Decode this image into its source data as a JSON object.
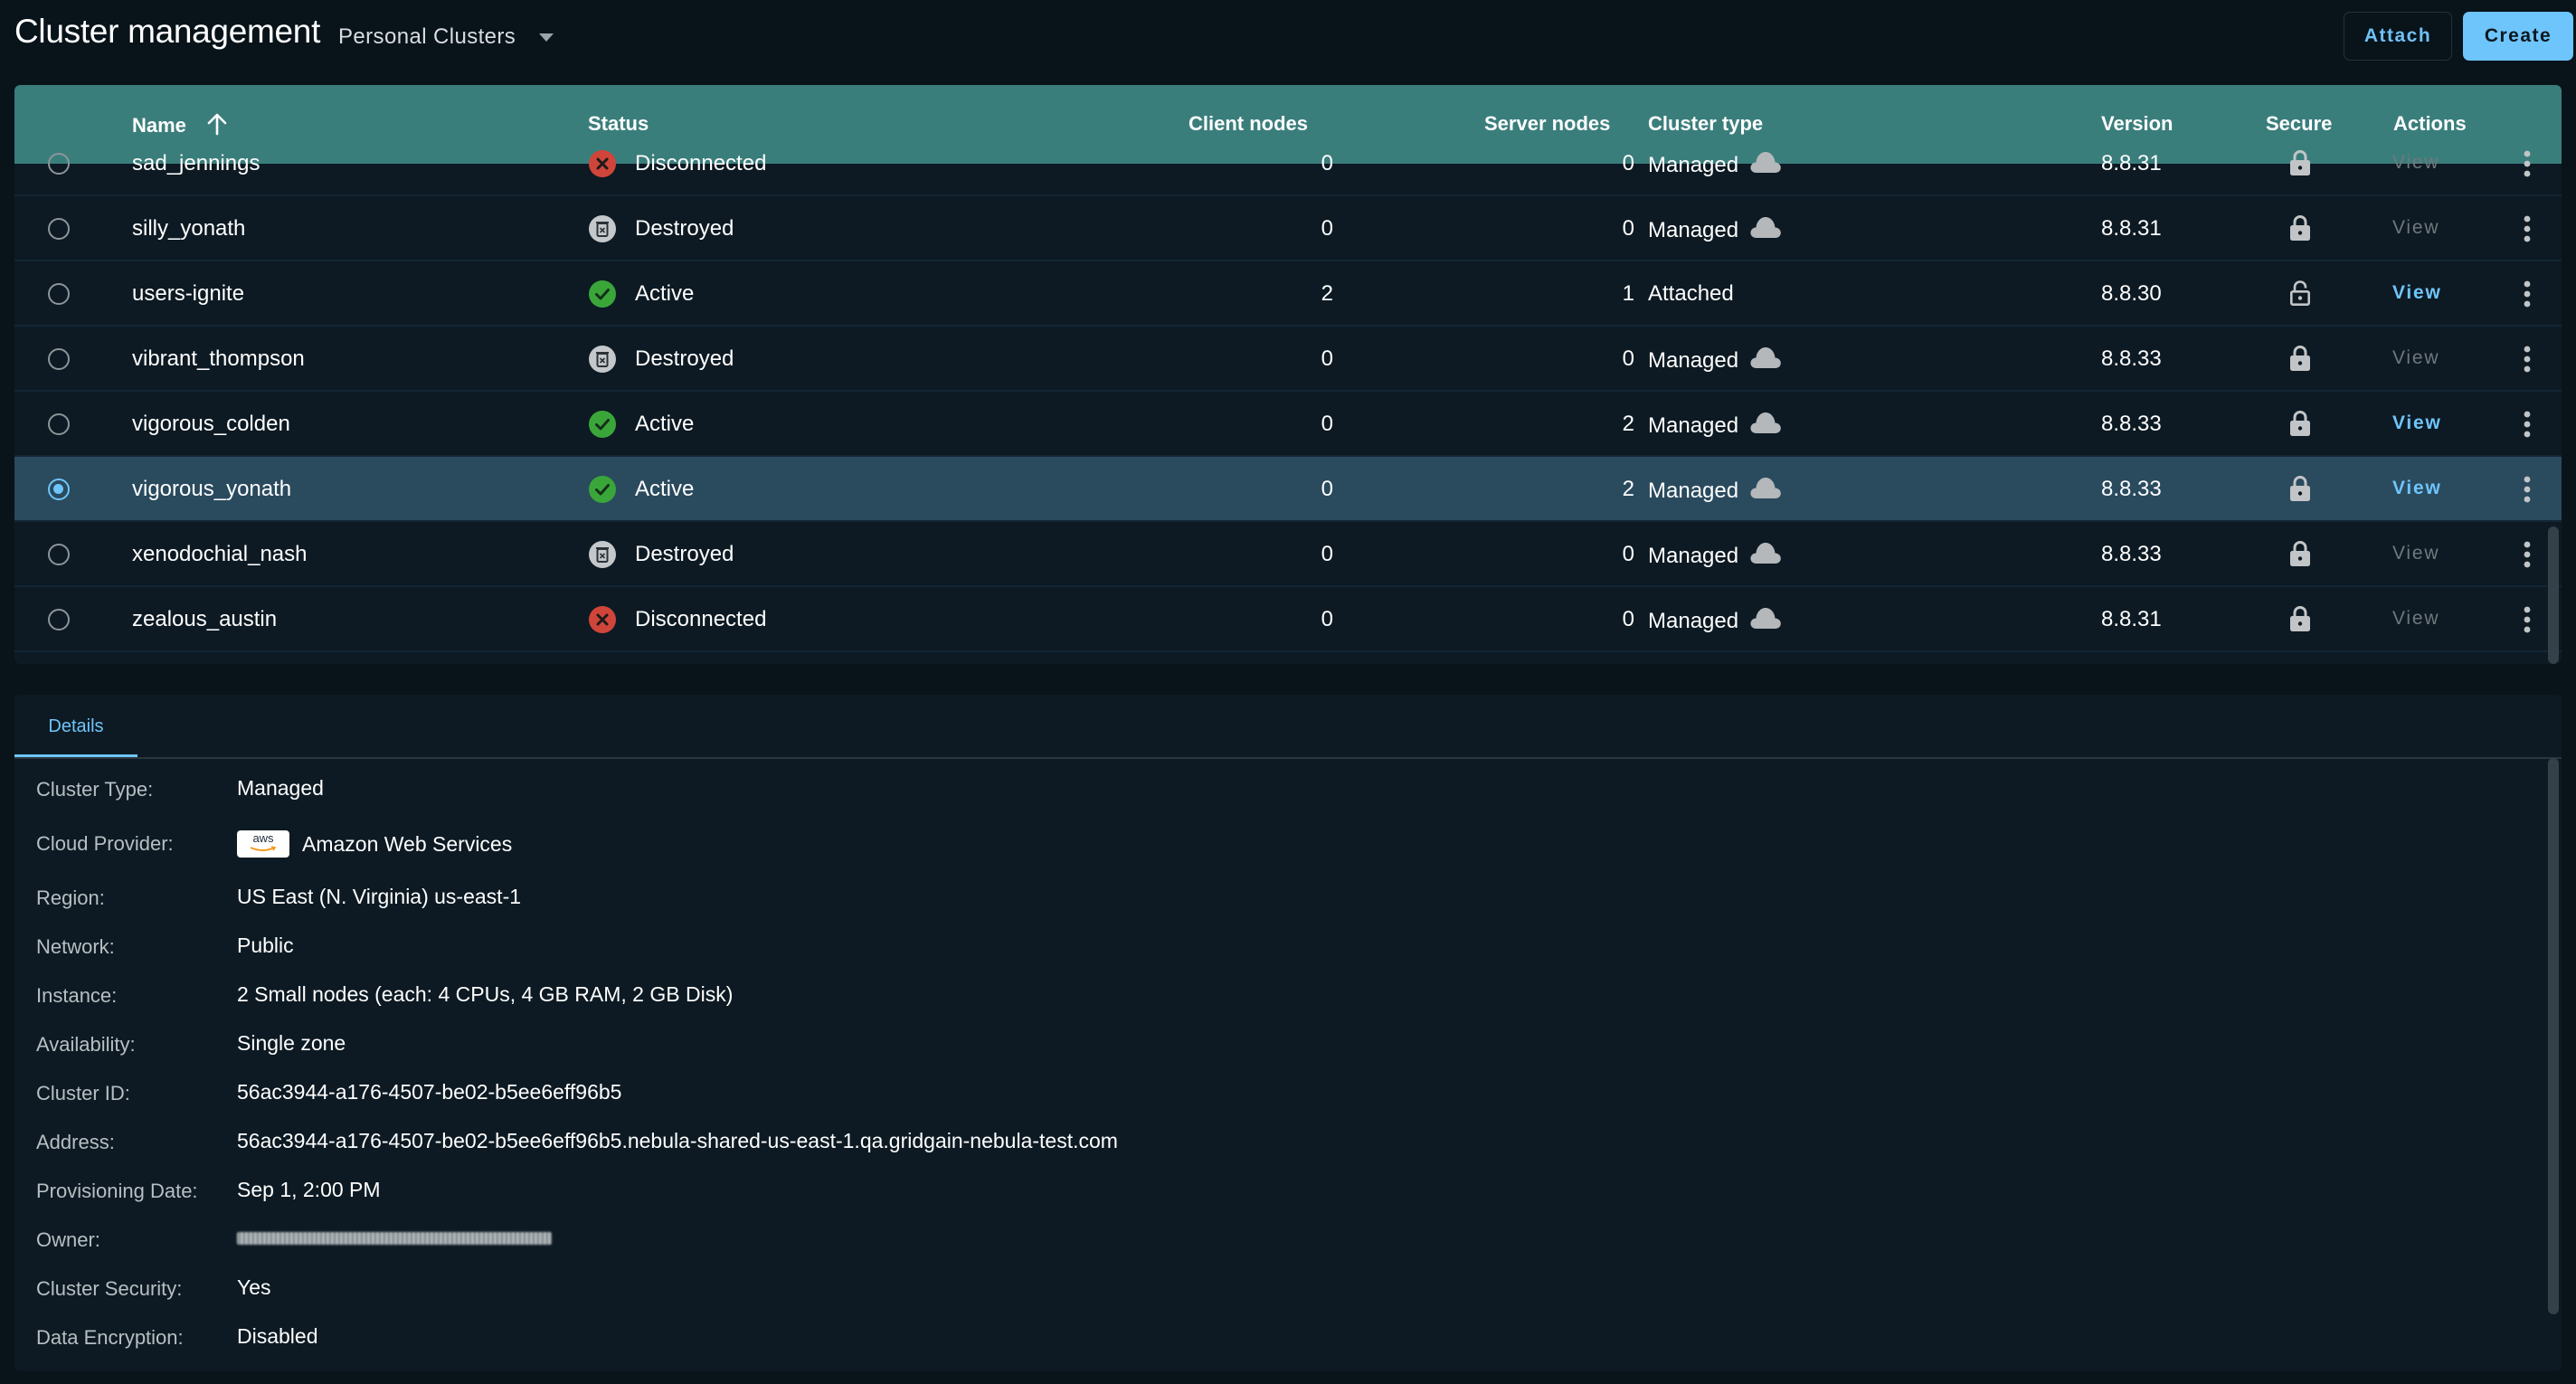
{
  "header": {
    "title": "Cluster management",
    "scope_selector": "Personal Clusters",
    "attach_label": "Attach",
    "create_label": "Create"
  },
  "table": {
    "columns": {
      "name": "Name",
      "status": "Status",
      "client_nodes": "Client nodes",
      "server_nodes": "Server nodes",
      "cluster_type": "Cluster type",
      "version": "Version",
      "secure": "Secure",
      "actions": "Actions"
    },
    "sort": {
      "column": "Name",
      "direction": "ascending"
    },
    "view_label": "View",
    "rows": [
      {
        "name": "sad_jennings",
        "status": "Disconnected",
        "status_icon": "x-circle-icon",
        "client_nodes": "0",
        "server_nodes": "0",
        "cluster_type": "Managed",
        "cloud": true,
        "version": "8.8.31",
        "secure": true,
        "view_enabled": false,
        "selected": false
      },
      {
        "name": "silly_yonath",
        "status": "Destroyed",
        "status_icon": "trash-icon",
        "client_nodes": "0",
        "server_nodes": "0",
        "cluster_type": "Managed",
        "cloud": true,
        "version": "8.8.31",
        "secure": true,
        "view_enabled": false,
        "selected": false
      },
      {
        "name": "users-ignite",
        "status": "Active",
        "status_icon": "check-circle-icon",
        "client_nodes": "2",
        "server_nodes": "1",
        "cluster_type": "Attached",
        "cloud": false,
        "version": "8.8.30",
        "secure": false,
        "view_enabled": true,
        "selected": false
      },
      {
        "name": "vibrant_thompson",
        "status": "Destroyed",
        "status_icon": "trash-icon",
        "client_nodes": "0",
        "server_nodes": "0",
        "cluster_type": "Managed",
        "cloud": true,
        "version": "8.8.33",
        "secure": true,
        "view_enabled": false,
        "selected": false
      },
      {
        "name": "vigorous_colden",
        "status": "Active",
        "status_icon": "check-circle-icon",
        "client_nodes": "0",
        "server_nodes": "2",
        "cluster_type": "Managed",
        "cloud": true,
        "version": "8.8.33",
        "secure": true,
        "view_enabled": true,
        "selected": false
      },
      {
        "name": "vigorous_yonath",
        "status": "Active",
        "status_icon": "check-circle-icon",
        "client_nodes": "0",
        "server_nodes": "2",
        "cluster_type": "Managed",
        "cloud": true,
        "version": "8.8.33",
        "secure": true,
        "view_enabled": true,
        "selected": true
      },
      {
        "name": "xenodochial_nash",
        "status": "Destroyed",
        "status_icon": "trash-icon",
        "client_nodes": "0",
        "server_nodes": "0",
        "cluster_type": "Managed",
        "cloud": true,
        "version": "8.8.33",
        "secure": true,
        "view_enabled": false,
        "selected": false
      },
      {
        "name": "zealous_austin",
        "status": "Disconnected",
        "status_icon": "x-circle-icon",
        "client_nodes": "0",
        "server_nodes": "0",
        "cluster_type": "Managed",
        "cloud": true,
        "version": "8.8.31",
        "secure": true,
        "view_enabled": false,
        "selected": false
      }
    ]
  },
  "details": {
    "tab_label": "Details",
    "fields": [
      {
        "label": "Cluster Type:",
        "value": "Managed"
      },
      {
        "label": "Cloud Provider:",
        "value": "Amazon Web Services",
        "logo": "aws"
      },
      {
        "label": "Region:",
        "value": "US East (N. Virginia) us-east-1"
      },
      {
        "label": "Network:",
        "value": "Public"
      },
      {
        "label": "Instance:",
        "value": "2 Small nodes (each: 4 CPUs, 4 GB RAM, 2 GB Disk)"
      },
      {
        "label": "Availability:",
        "value": "Single zone"
      },
      {
        "label": "Cluster ID:",
        "value": "56ac3944-a176-4507-be02-b5ee6eff96b5"
      },
      {
        "label": "Address:",
        "value": "56ac3944-a176-4507-be02-b5ee6eff96b5.nebula-shared-us-east-1.qa.gridgain-nebula-test.com"
      },
      {
        "label": "Provisioning Date:",
        "value": "Sep 1, 2:00 PM"
      },
      {
        "label": "Owner:",
        "value": "",
        "redacted": true
      },
      {
        "label": "Cluster Security:",
        "value": "Yes"
      },
      {
        "label": "Data Encryption:",
        "value": "Disabled"
      }
    ],
    "aws_logo_text": "aws"
  },
  "colors": {
    "background": "#08131a",
    "card": "#0d1a23",
    "header_teal": "#3a7e7c",
    "accent": "#6ec5fb",
    "selected_row": "#2a4a5e",
    "active": "#3aa63a",
    "disconnected": "#d0453a",
    "destroyed": "#c4c8ca"
  }
}
